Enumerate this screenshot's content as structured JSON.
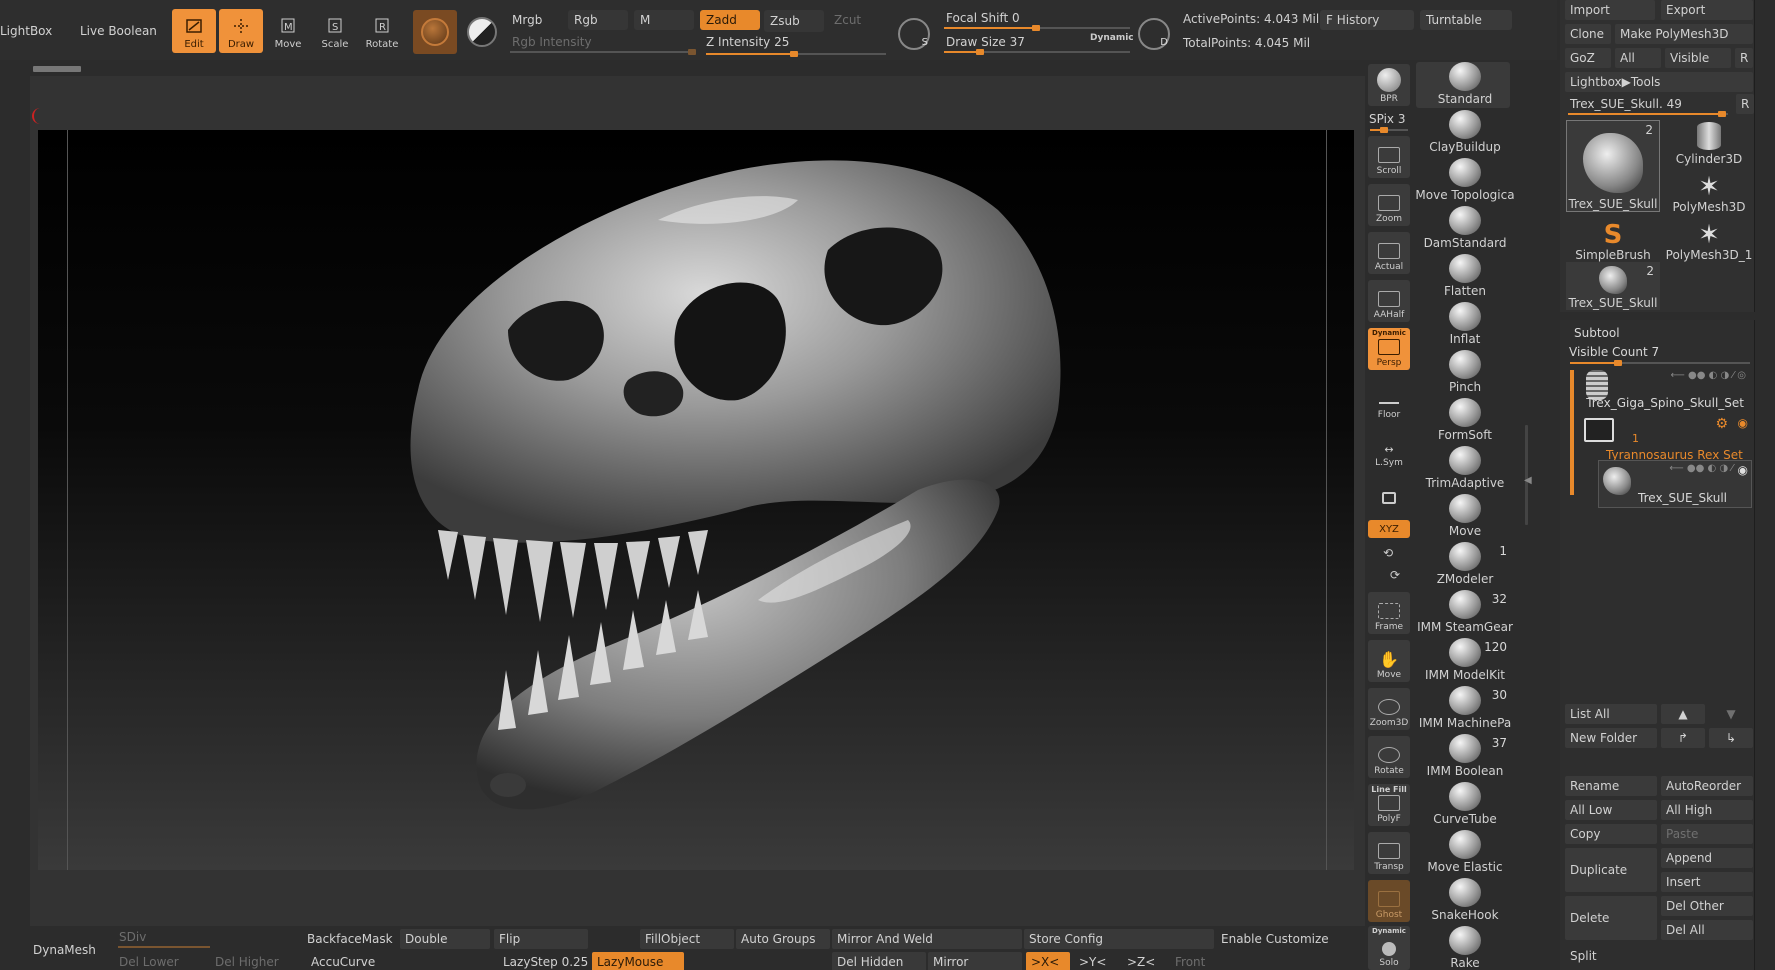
{
  "top": {
    "lightbox": "LightBox",
    "live_boolean": "Live Boolean",
    "modes": [
      {
        "label": "Edit",
        "icon": "edit-icon"
      },
      {
        "label": "Draw",
        "icon": "draw-icon"
      },
      {
        "label": "Move",
        "icon": "move-icon"
      },
      {
        "label": "Scale",
        "icon": "scale-icon"
      },
      {
        "label": "Rotate",
        "icon": "rotate-icon"
      }
    ],
    "mrgb": "Mrgb",
    "rgb": "Rgb",
    "m": "M",
    "rgb_intensity": "Rgb Intensity",
    "zadd": "Zadd",
    "zsub": "Zsub",
    "zcut": "Zcut",
    "z_intensity_label": "Z Intensity",
    "z_intensity_value": "25",
    "focal_shift_label": "Focal Shift",
    "focal_shift_value": "0",
    "draw_size_label": "Draw Size",
    "draw_size_value": "37",
    "dynamic": "Dynamic",
    "s_label": "S",
    "d_label": "D",
    "active_points": "ActivePoints: 4.043 Mil",
    "total_points": "TotalPoints: 4.045 Mil",
    "f_history": "F History",
    "turntable": "Turntable"
  },
  "right_top": {
    "import": "Import",
    "export": "Export",
    "clone": "Clone",
    "make_polymesh": "Make PolyMesh3D",
    "goz": "GoZ",
    "all": "All",
    "visible": "Visible",
    "r": "R",
    "lightbox_tools": "Lightbox▶Tools",
    "current_tool": "Trex_SUE_Skull. 49",
    "current_tool_r": "R",
    "tools": [
      {
        "label": "Trex_SUE_Skull",
        "num": "2"
      },
      {
        "label": "Cylinder3D",
        "num": ""
      },
      {
        "label": "PolyMesh3D",
        "num": ""
      },
      {
        "label": "SimpleBrush",
        "num": ""
      },
      {
        "label": "PolyMesh3D_1",
        "num": ""
      },
      {
        "label": "Trex_SUE_Skull",
        "num": "2"
      }
    ]
  },
  "subtool": {
    "title": "Subtool",
    "visible_count": "Visible Count 7",
    "items": [
      {
        "label": "Trex_Giga_Spino_Skull_Set"
      },
      {
        "label": "Tyrannosaurus Rex Set",
        "num": "1"
      },
      {
        "label": "Trex_SUE_Skull"
      }
    ],
    "list_all": "List All",
    "new_folder": "New Folder",
    "rename": "Rename",
    "autoreorder": "AutoReorder",
    "all_low": "All Low",
    "all_high": "All High",
    "copy": "Copy",
    "paste": "Paste",
    "duplicate": "Duplicate",
    "append": "Append",
    "insert": "Insert",
    "delete": "Delete",
    "del_other": "Del Other",
    "del_all": "Del All",
    "split": "Split"
  },
  "viewtools": {
    "bpr": "BPR",
    "spix": "SPix 3",
    "scroll": "Scroll",
    "zoom": "Zoom",
    "actual": "Actual",
    "aahalf": "AAHalf",
    "dynamic": "Dynamic",
    "persp": "Persp",
    "floor": "Floor",
    "lsym": "L.Sym",
    "xyz": "XYZ",
    "frame": "Frame",
    "move": "Move",
    "zoom3d": "Zoom3D",
    "rotate": "Rotate",
    "linefill": "Line Fill",
    "polyf": "PolyF",
    "transp": "Transp",
    "ghost": "Ghost",
    "solo_dynamic": "Dynamic",
    "solo": "Solo"
  },
  "brushes": [
    {
      "label": "Standard",
      "num": ""
    },
    {
      "label": "ClayBuildup",
      "num": ""
    },
    {
      "label": "Move Topologica",
      "num": ""
    },
    {
      "label": "DamStandard",
      "num": ""
    },
    {
      "label": "Flatten",
      "num": ""
    },
    {
      "label": "Inflat",
      "num": ""
    },
    {
      "label": "Pinch",
      "num": ""
    },
    {
      "label": "FormSoft",
      "num": ""
    },
    {
      "label": "TrimAdaptive",
      "num": ""
    },
    {
      "label": "Move",
      "num": ""
    },
    {
      "label": "ZModeler",
      "num": "1"
    },
    {
      "label": "IMM SteamGear",
      "num": "32"
    },
    {
      "label": "IMM ModelKit",
      "num": "120"
    },
    {
      "label": "IMM MachinePa",
      "num": "30"
    },
    {
      "label": "IMM Boolean",
      "num": "37"
    },
    {
      "label": "CurveTube",
      "num": ""
    },
    {
      "label": "Move Elastic",
      "num": ""
    },
    {
      "label": "SnakeHook",
      "num": ""
    },
    {
      "label": "Rake",
      "num": ""
    }
  ],
  "bottom": {
    "dynamesh": "DynaMesh",
    "sdiv": "SDiv",
    "del_lower": "Del Lower",
    "del_higher": "Del Higher",
    "backfacemask": "BackfaceMask",
    "double": "Double",
    "flip": "Flip",
    "accucurve": "AccuCurve",
    "lazystep_label": "LazyStep",
    "lazystep_value": "0.25",
    "lazymouse": "LazyMouse",
    "fillobject": "FillObject",
    "auto_groups": "Auto Groups",
    "mirror_and_weld": "Mirror And Weld",
    "del_hidden": "Del Hidden",
    "mirror": "Mirror",
    "x": ">X<",
    "y": ">Y<",
    "z": ">Z<",
    "front": "Front",
    "store_config": "Store Config",
    "enable_customize": "Enable Customize"
  },
  "colors": {
    "accent": "#e8892b",
    "background": "#2c2c2c",
    "canvas": "#141414"
  }
}
